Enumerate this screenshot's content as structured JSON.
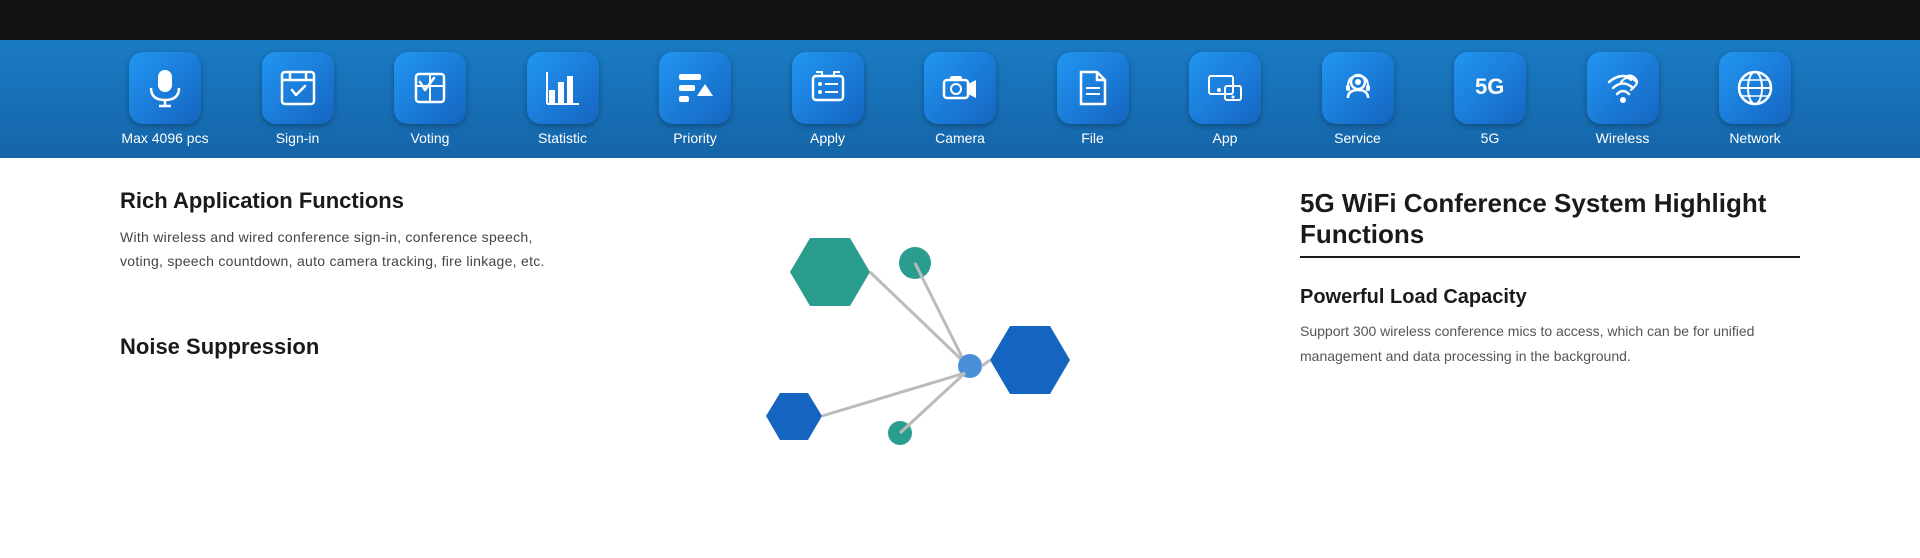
{
  "topBar": {
    "height": 40
  },
  "toolbar": {
    "items": [
      {
        "id": "max4096",
        "label": "Max 4096 pcs",
        "icon": "mic"
      },
      {
        "id": "signin",
        "label": "Sign-in",
        "icon": "signin"
      },
      {
        "id": "voting",
        "label": "Voting",
        "icon": "voting"
      },
      {
        "id": "statistic",
        "label": "Statistic",
        "icon": "statistic"
      },
      {
        "id": "priority",
        "label": "Priority",
        "icon": "priority"
      },
      {
        "id": "apply",
        "label": "Apply",
        "icon": "apply"
      },
      {
        "id": "camera",
        "label": "Camera",
        "icon": "camera"
      },
      {
        "id": "file",
        "label": "File",
        "icon": "file"
      },
      {
        "id": "app",
        "label": "App",
        "icon": "app"
      },
      {
        "id": "service",
        "label": "Service",
        "icon": "service"
      },
      {
        "id": "5g",
        "label": "5G",
        "icon": "5g"
      },
      {
        "id": "wireless",
        "label": "Wireless",
        "icon": "wireless"
      },
      {
        "id": "network",
        "label": "Network",
        "icon": "network"
      }
    ]
  },
  "content": {
    "left": {
      "richAppTitle": "Rich Application Functions",
      "richAppText": "With wireless and wired conference sign-in, conference speech, voting, speech countdown, auto camera tracking, fire linkage, etc.",
      "noiseTitle": "Noise Suppression"
    },
    "right": {
      "highlightTitle": "5G WiFi Conference System  Highlight Functions",
      "capacityTitle": "Powerful Load Capacity",
      "capacityText": "Support 300 wireless conference mics to access, which can be  for unified management and data processing in the background."
    }
  }
}
